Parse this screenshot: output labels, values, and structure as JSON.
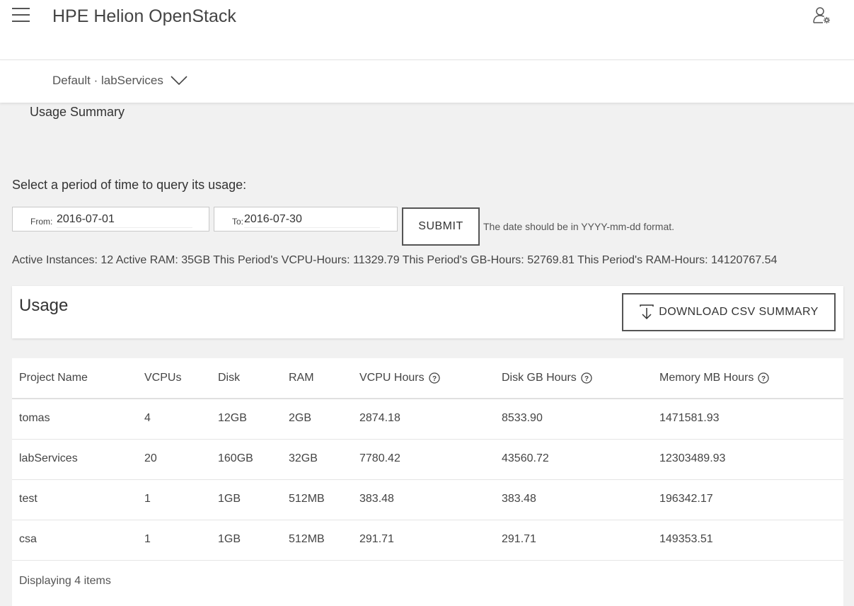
{
  "header": {
    "app_title": "HPE Helion OpenStack",
    "menu_icon": "hamburger-menu-icon",
    "user_icon": "user-settings-icon"
  },
  "project_selector": {
    "label": "Default · labServices",
    "icon": "chevron-down-icon"
  },
  "page": {
    "title": "Usage Summary",
    "period_prompt": "Select a period of time to query its usage:"
  },
  "date_form": {
    "from_label": "From:",
    "from_value": "2016-07-01",
    "to_label": "To:",
    "to_value": "2016-07-30",
    "submit_label": "SUBMIT",
    "hint": "The date should be in YYYY-mm-dd format."
  },
  "stats_line": "Active Instances: 12 Active RAM: 35GB This Period's VCPU-Hours: 11329.79 This Period's GB-Hours: 52769.81 This Period's RAM-Hours: 14120767.54",
  "usage_panel": {
    "title": "Usage",
    "download_label": "DOWNLOAD CSV SUMMARY",
    "download_icon": "download-icon"
  },
  "table": {
    "columns": [
      "Project Name",
      "VCPUs",
      "Disk",
      "RAM",
      "VCPU Hours",
      "Disk GB Hours",
      "Memory MB Hours"
    ],
    "rows": [
      [
        "tomas",
        "4",
        "12GB",
        "2GB",
        "2874.18",
        "8533.90",
        "1471581.93"
      ],
      [
        "labServices",
        "20",
        "160GB",
        "32GB",
        "7780.42",
        "43560.72",
        "12303489.93"
      ],
      [
        "test",
        "1",
        "1GB",
        "512MB",
        "383.48",
        "383.48",
        "196342.17"
      ],
      [
        "csa",
        "1",
        "1GB",
        "512MB",
        "291.71",
        "291.71",
        "149353.51"
      ]
    ],
    "footer": "Displaying 4 items"
  },
  "colors": {
    "background": "#f1f1f1",
    "panel": "#ffffff",
    "text": "#333333",
    "border": "#555555"
  }
}
